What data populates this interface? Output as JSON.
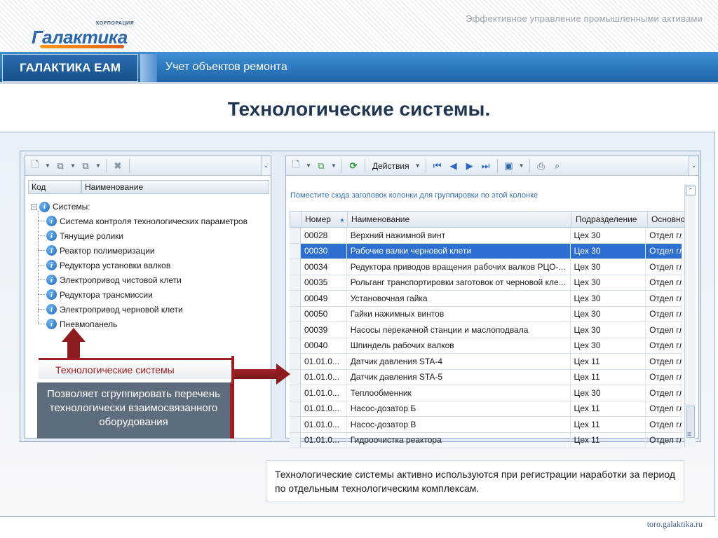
{
  "header": {
    "tagline": "Эффективное управление промышленными активами",
    "logo_small": "КОРПОРАЦИЯ",
    "logo_text": "Галактика"
  },
  "nav": {
    "product": "ГАЛАКТИКА ЕАМ",
    "module": "Учет объектов ремонта"
  },
  "page_title": "Технологические системы.",
  "left_panel": {
    "columns": [
      "Код",
      "Наименование"
    ],
    "tree_root": "Системы:",
    "tree_items": [
      "Система контроля технологических параметров",
      "Тянущие ролики",
      "Реактор полимеризации",
      "Редуктора установки валков",
      "Электропривод  чистовой клети",
      "Редуктора трансмиссии",
      "Электропривод  черновой клети",
      "Пневмопанель"
    ]
  },
  "right_panel": {
    "actions_label": "Действия",
    "group_hint": "Поместите сюда заголовок колонки для группировки по этой колонке",
    "columns": [
      "Номер",
      "Наименование",
      "Подразделение",
      "Основно"
    ],
    "rows": [
      {
        "num": "00028",
        "name": "Верхний нажимной винт",
        "dept": "Цех 30",
        "base": "Отдел гл"
      },
      {
        "num": "00030",
        "name": "Рабочие валки черновой клети",
        "dept": "Цех 30",
        "base": "Отдел гл",
        "selected": true
      },
      {
        "num": "00034",
        "name": "Редуктора приводов вращения  рабочих валков РЦО-...",
        "dept": "Цех 30",
        "base": "Отдел гл"
      },
      {
        "num": "00035",
        "name": "Рольганг транспортировки заготовок от черновой кле...",
        "dept": "Цех 30",
        "base": "Отдел гл"
      },
      {
        "num": "00049",
        "name": "Установочная гайка",
        "dept": "Цех 30",
        "base": "Отдел гл"
      },
      {
        "num": "00050",
        "name": "Гайки нажимных винтов",
        "dept": "Цех 30",
        "base": "Отдел гл"
      },
      {
        "num": "00039",
        "name": "Насосы перекачной станции и маслоподвала",
        "dept": "Цех 30",
        "base": "Отдел гл"
      },
      {
        "num": "00040",
        "name": "Шпиндель рабочих валков",
        "dept": "Цех 30",
        "base": "Отдел гл"
      },
      {
        "num": "01.01.0...",
        "name": "Датчик давления STA-4",
        "dept": "Цех 11",
        "base": "Отдел гл"
      },
      {
        "num": "01.01.0...",
        "name": "Датчик давления STA-5",
        "dept": "Цех 11",
        "base": "Отдел гл"
      },
      {
        "num": "01.01.0...",
        "name": "Теплообменник",
        "dept": "Цех 30",
        "base": "Отдел гл"
      },
      {
        "num": "01.01.0...",
        "name": "Насос-дозатор Б",
        "dept": "Цех 11",
        "base": "Отдел гл"
      },
      {
        "num": "01.01.0...",
        "name": "Насос-дозатор В",
        "dept": "Цех 11",
        "base": "Отдел гл"
      },
      {
        "num": "01.01.0...",
        "name": "Гидроочистка реактора",
        "dept": "Цех 11",
        "base": "Отдел гл"
      }
    ]
  },
  "callout": {
    "label": "Технологические системы",
    "text": "Позволяет  сгруппировать перечень технологически взаимосвязанного оборудования"
  },
  "note": "Технологические системы активно используются при регистрации наработки за период по отдельным технологическим комплексам.",
  "footer_url": "toro.galaktika.ru",
  "colors": {
    "brand_blue": "#1e66ad",
    "accent_red": "#8e1b1e",
    "selection": "#2d6fd0"
  }
}
